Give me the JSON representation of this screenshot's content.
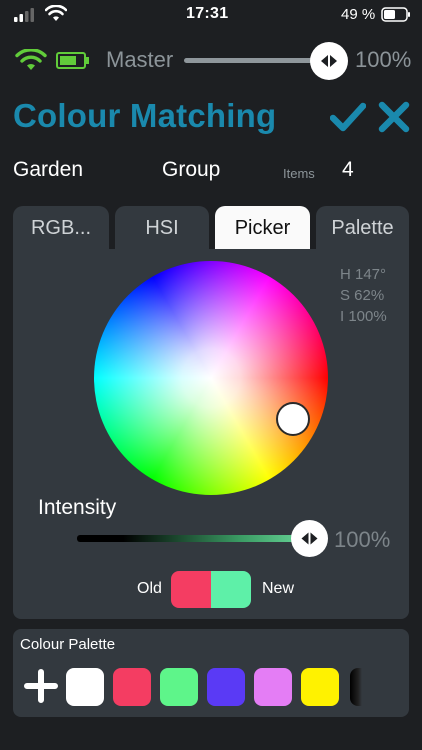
{
  "status_bar": {
    "time": "17:31",
    "battery_percent": "49 %"
  },
  "master": {
    "label": "Master",
    "value": "100%",
    "level": 1.0
  },
  "header": {
    "title": "Colour Matching",
    "confirm_icon": "check-icon",
    "cancel_icon": "close-icon"
  },
  "group_row": {
    "name": "Garden",
    "type": "Group",
    "items_label": "Items",
    "items_count": "4"
  },
  "tabs": [
    {
      "label": "RGB...",
      "active": false
    },
    {
      "label": "HSI",
      "active": false
    },
    {
      "label": "Picker",
      "active": true
    },
    {
      "label": "Palette",
      "active": false
    }
  ],
  "picker": {
    "hue": "H 147°",
    "saturation": "S 62%",
    "intensity_readout": "I 100%",
    "intensity_label": "Intensity",
    "intensity_value": "100%",
    "intensity_level": 1.0,
    "old_label": "Old",
    "new_label": "New",
    "old_color": "#f43d62",
    "new_color": "#5ef0a8"
  },
  "palette": {
    "label": "Colour Palette",
    "add_icon": "plus-icon",
    "colors": [
      "#ffffff",
      "#f43d62",
      "#5ef58a",
      "#5a3af5",
      "#e47df5",
      "#fff200"
    ]
  },
  "colors": {
    "accent": "#1a89ad",
    "panel": "#33393f",
    "background": "#1d1f22",
    "muted_text": "#8c9499"
  }
}
